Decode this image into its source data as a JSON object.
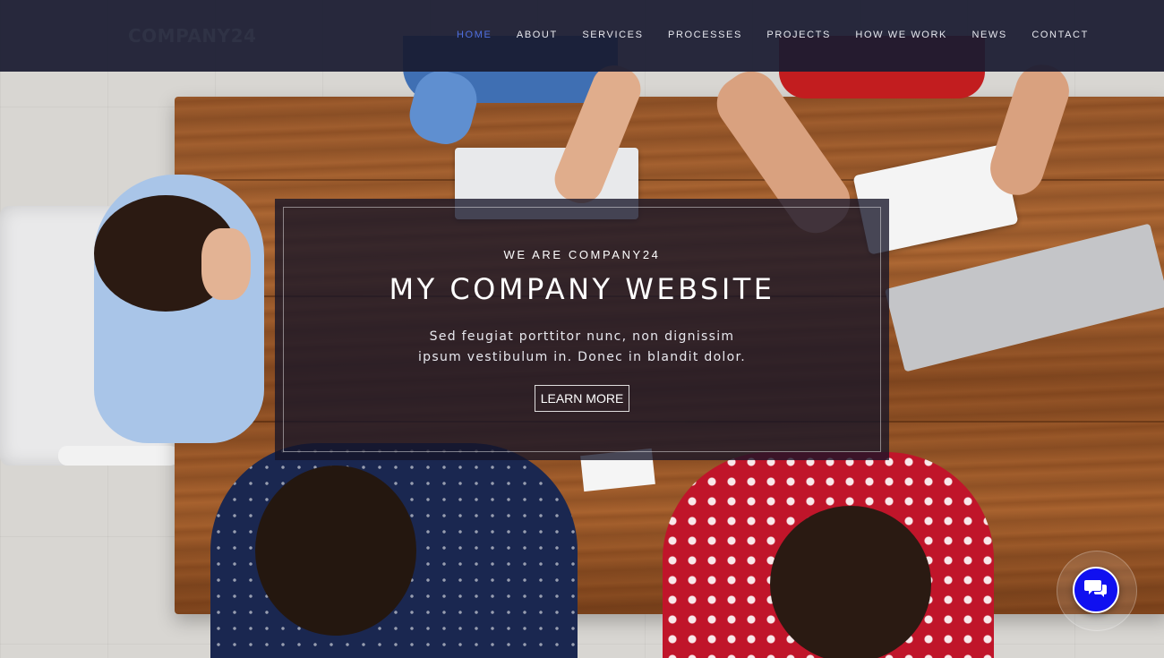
{
  "header": {
    "logo": "COMPANY24",
    "nav": [
      {
        "label": "HOME",
        "active": true
      },
      {
        "label": "ABOUT",
        "active": false
      },
      {
        "label": "SERVICES",
        "active": false
      },
      {
        "label": "PROCESSES",
        "active": false
      },
      {
        "label": "PROJECTS",
        "active": false
      },
      {
        "label": "HOW WE WORK",
        "active": false
      },
      {
        "label": "NEWS",
        "active": false
      },
      {
        "label": "CONTACT",
        "active": false
      }
    ]
  },
  "hero": {
    "kicker": "WE ARE COMPANY24",
    "title": "MY COMPANY WEBSITE",
    "tagline_line1": "Sed feugiat porttitor nunc, non dignissim",
    "tagline_line2": "ipsum vestibulum in. Donec in blandit dolor.",
    "cta_label": "LEARN MORE",
    "background": "overhead-team-meeting-photo"
  },
  "chat_widget": {
    "icon": "chat-bubbles-icon"
  },
  "colors": {
    "nav_bg": "#191b30",
    "nav_active": "#4e6fe0",
    "overlay_bg": "#161428",
    "chat_accent": "#1010f0"
  }
}
